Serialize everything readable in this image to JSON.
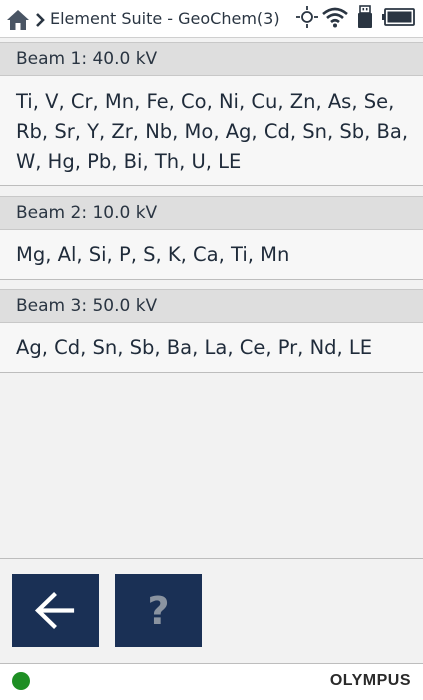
{
  "header": {
    "title": "Element Suite - GeoChem(3)",
    "icons": [
      "home-icon",
      "chevron-right-icon",
      "sun-icon",
      "wifi-icon",
      "usb-icon",
      "battery-icon"
    ]
  },
  "beams": [
    {
      "label": "Beam 1:  40.0 kV",
      "elements": "Ti, V, Cr, Mn, Fe, Co, Ni, Cu, Zn, As, Se, Rb, Sr, Y, Zr, Nb, Mo, Ag, Cd, Sn, Sb, Ba, W, Hg, Pb, Bi, Th, U, LE"
    },
    {
      "label": "Beam 2:  10.0 kV",
      "elements": "Mg, Al, Si, P, S, K, Ca, Ti, Mn"
    },
    {
      "label": "Beam 3:  50.0 kV",
      "elements": "Ag, Cd, Sn, Sb, Ba, La, Ce, Pr, Nd, LE"
    }
  ],
  "buttons": {
    "back_icon": "arrow-left-icon",
    "help_label": "?"
  },
  "footer": {
    "status_color": "#1e8f24",
    "brand": "OLYMPUS"
  },
  "colors": {
    "button_bg": "#1a3055",
    "header_band": "#dedede"
  }
}
